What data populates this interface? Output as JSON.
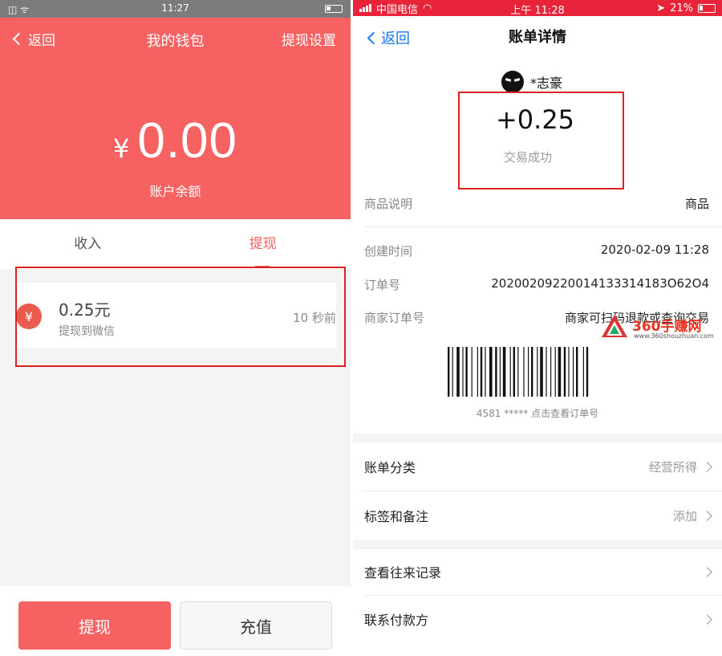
{
  "left": {
    "status": {
      "carrier_icons": "◫ ᯤ",
      "time": "11:27"
    },
    "nav": {
      "back": "返回",
      "title": "我的钱包",
      "settings": "提现设置"
    },
    "balance": {
      "currency": "¥",
      "amount": "0.00",
      "label": "账户余额"
    },
    "tabs": [
      {
        "label": "收入"
      },
      {
        "label": "提现"
      }
    ],
    "record": {
      "icon_text": "¥",
      "amount": "0.25元",
      "desc": "提现到微信",
      "time": "10 秒前"
    },
    "buttons": {
      "withdraw": "提现",
      "topup": "充值"
    },
    "colors": {
      "primary": "#f66262",
      "highlight_box": "#e02020"
    }
  },
  "right": {
    "status": {
      "carrier": "中国电信",
      "time": "上午 11:28",
      "battery": "21%"
    },
    "nav": {
      "back": "返回",
      "title": "账单详情"
    },
    "payer": "*志豪",
    "amount": "+0.25",
    "result": "交易成功",
    "details": [
      {
        "key": "商品说明",
        "value": "商品"
      },
      {
        "key": "创建时间",
        "value": "2020-02-09 11:28"
      },
      {
        "key": "订单号",
        "value": "20200209220014133314183O62O4"
      },
      {
        "key": "商家订单号",
        "value": "商家可扫码退款或查询交易"
      }
    ],
    "barcode_caption": "4581 ***** 点击查看订单号",
    "list": [
      {
        "label": "账单分类",
        "value": "经营所得"
      },
      {
        "label": "标签和备注",
        "value": "添加"
      },
      {
        "label": "查看往来记录",
        "value": ""
      },
      {
        "label": "联系付款方",
        "value": ""
      }
    ],
    "watermark": {
      "name": "360手赚网",
      "url": "www.360shouzhuan.com"
    },
    "colors": {
      "accent": "#1677ff",
      "status_bar": "#e7243a"
    }
  }
}
